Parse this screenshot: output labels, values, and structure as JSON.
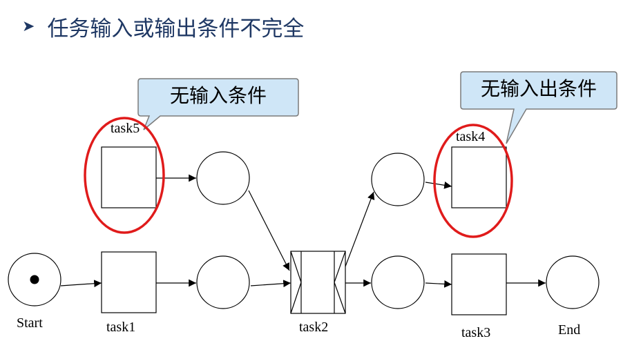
{
  "slide": {
    "bullet_icon": "arrowhead-bullet-icon",
    "title": "任务输入或输出条件不完全"
  },
  "colors": {
    "title": "#1f3864",
    "callout_fill": "#cfe6f7",
    "highlight_ellipse": "#e01b1b"
  },
  "callouts": {
    "left": "无输入条件",
    "right": "无输入出条件"
  },
  "labels": {
    "start": "Start",
    "end": "End",
    "task1": "task1",
    "task2": "task2",
    "task3": "task3",
    "task4": "task4",
    "task5": "task5"
  }
}
